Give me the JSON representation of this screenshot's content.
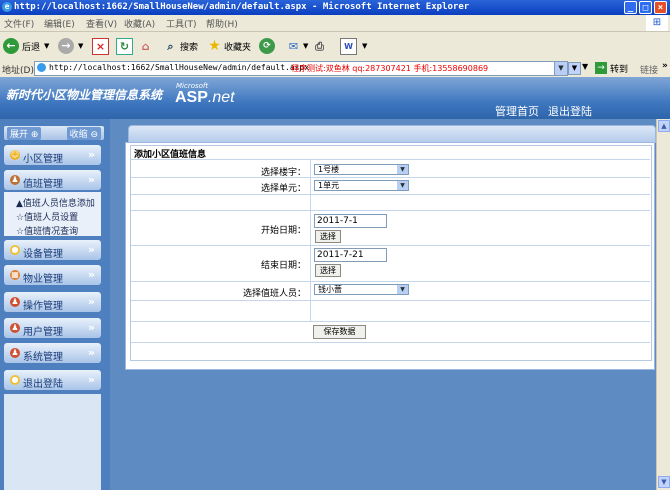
{
  "browser": {
    "title": "http://localhost:1662/SmallHouseNew/admin/default.aspx - Microsoft Internet Explorer",
    "menu": [
      "文件(F)",
      "编辑(E)",
      "查看(V)",
      "收藏(A)",
      "工具(T)",
      "帮助(H)"
    ],
    "toolbar": {
      "back": "后退",
      "search": "搜索",
      "favorites": "收藏夹"
    },
    "address_label": "地址(D)",
    "url": "http://localhost:1662/SmallHouseNew/admin/default.aspx",
    "address_note": "程序测试:双鱼林 qq:287307421 手机:13558690869",
    "go": "转到",
    "links": "链接"
  },
  "header": {
    "app_title": "新时代小区物业管理信息系统",
    "logo_small": "Microsoft",
    "logo_main": "ASP",
    "logo_net": ".net",
    "links": [
      "管理首页",
      "退出登陆"
    ]
  },
  "sidebar": {
    "expand": "展开",
    "collapse": "收缩",
    "items": [
      {
        "label": "小区管理",
        "icon": "smiley-icon",
        "color": "#f0b020"
      },
      {
        "label": "值班管理",
        "icon": "users-icon",
        "color": "#c07030"
      },
      {
        "label": "设备管理",
        "icon": "bulb-icon",
        "color": "#f0c030"
      },
      {
        "label": "物业管理",
        "icon": "building-icon",
        "color": "#e08030"
      },
      {
        "label": "操作管理",
        "icon": "users-icon",
        "color": "#d05030"
      },
      {
        "label": "用户管理",
        "icon": "users-icon",
        "color": "#d05030"
      },
      {
        "label": "系统管理",
        "icon": "users-icon",
        "color": "#d05030"
      },
      {
        "label": "退出登陆",
        "icon": "bulb-icon",
        "color": "#f0c030"
      }
    ],
    "sub_items": [
      "▲值班人员信息添加",
      "☆值班人员设置",
      "☆值班情况查询"
    ]
  },
  "form": {
    "title": "添加小区值班信息",
    "building_label": "选择楼宇：",
    "building_value": "1号楼",
    "unit_label": "选择单元：",
    "unit_value": "1单元",
    "start_label": "开始日期：",
    "start_value": "2011-7-1",
    "end_label": "结束日期：",
    "end_value": "2011-7-21",
    "choose_button": "选择",
    "staff_label": "选择值班人员：",
    "staff_value": "钱小蔷",
    "save_button": "保存数据"
  }
}
